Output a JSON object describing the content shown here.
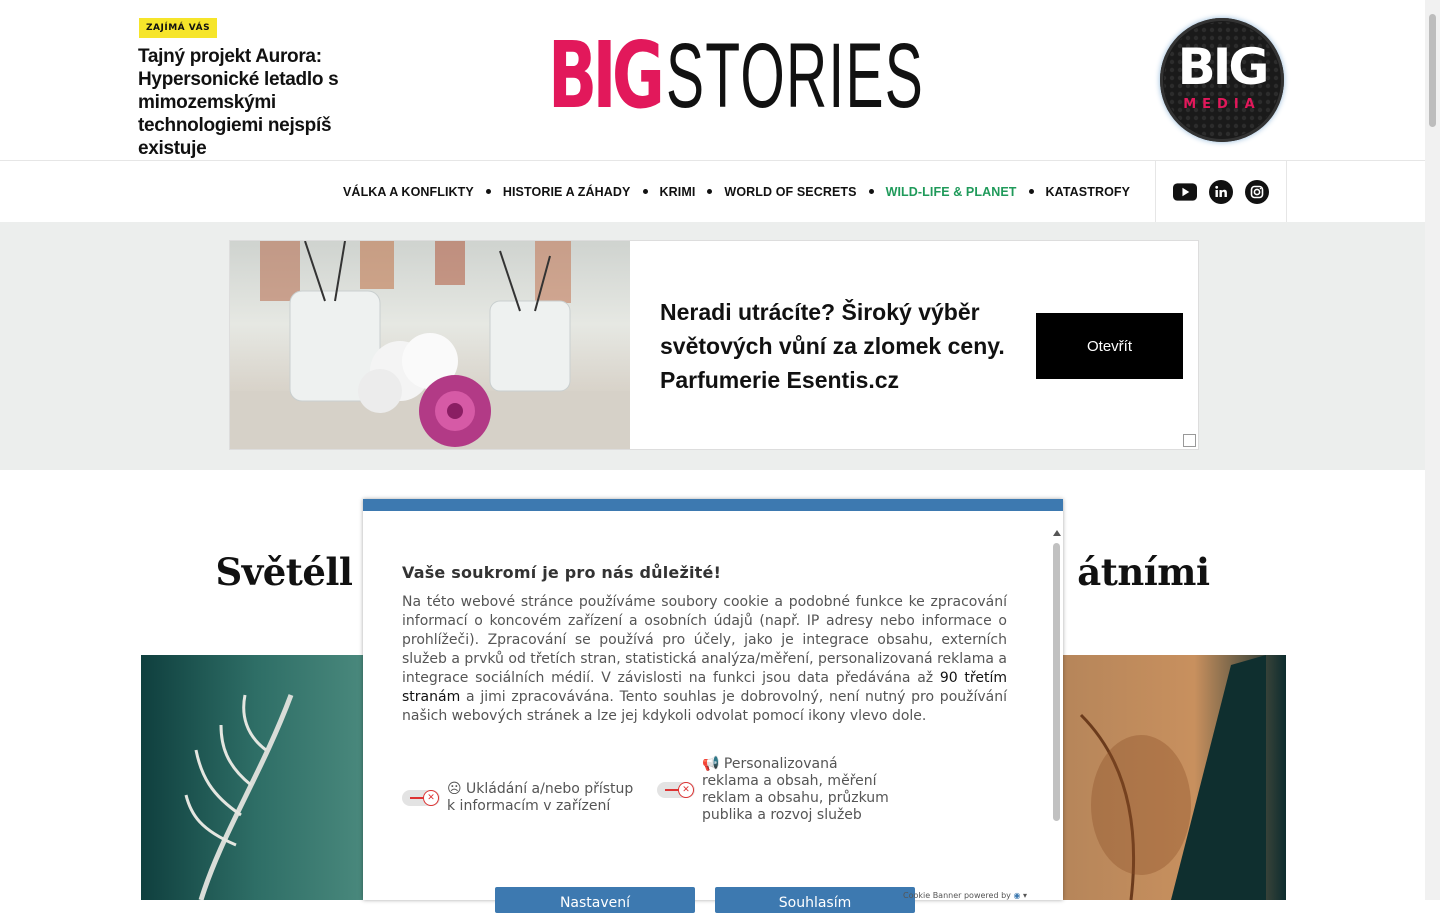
{
  "teaser": {
    "badge": "ZAJÍMÁ VÁS",
    "title": "Tajný projekt Aurora: Hypersonické letadlo s mimozemskými technologiemi nejspíš existuje"
  },
  "logo": {
    "part1": "BIG",
    "part2": "STORIES"
  },
  "media_badge": {
    "line1": "BIG",
    "line2": "MEDIA"
  },
  "nav": {
    "items": [
      {
        "label": "VÁLKA A KONFLIKTY"
      },
      {
        "label": "HISTORIE A ZÁHADY"
      },
      {
        "label": "KRIMI"
      },
      {
        "label": "WORLD OF SECRETS"
      },
      {
        "label": "WILD-LIFE & PLANET"
      },
      {
        "label": "KATASTROFY"
      }
    ],
    "active_index": 4,
    "social": [
      "youtube-icon",
      "linkedin-icon",
      "instagram-icon"
    ]
  },
  "ad": {
    "text": "Neradi utrácíte? Široký výběr světových vůní za zlomek ceny. Parfumerie Esentis.cz",
    "button": "Otevřít"
  },
  "article": {
    "title_left": "Světéll",
    "title_right": "átními"
  },
  "cookie": {
    "heading": "Vaše soukromí je pro nás důležité!",
    "body_before": "Na této webové stránce používáme soubory cookie a podobné funkce ke zpracování informací o koncovém zařízení a osobních údajů (např. IP adresy nebo informace o prohlížeči). Zpracování se používá pro účely, jako je integrace obsahu, externích služeb a prvků od třetích stran, statistická analýza/měření, personalizovaná reklama a integrace sociálních médií. V závislosti na funkci jsou data předávána až ",
    "body_link": "90 třetím stranám",
    "body_after": " a jimi zpracovávána. Tento souhlas je dobrovolný, není nutný pro používání našich webových stránek a lze jej kdykoli odvolat pomocí ikony vlevo dole.",
    "option1": "Ukládání a/nebo přístup k informacím v zařízení",
    "option2": "Personalizovaná reklama a obsah, měření reklam a obsahu, průzkum publika a rozvoj služeb",
    "btn_settings": "Nastavení",
    "btn_accept": "Souhlasím",
    "footer": "Cookie Banner powered by"
  },
  "colors": {
    "brand": "#e2185b",
    "nav_active": "#1f9a5a",
    "cookie_accent": "#3d79b0",
    "badge": "#f6e52a"
  }
}
